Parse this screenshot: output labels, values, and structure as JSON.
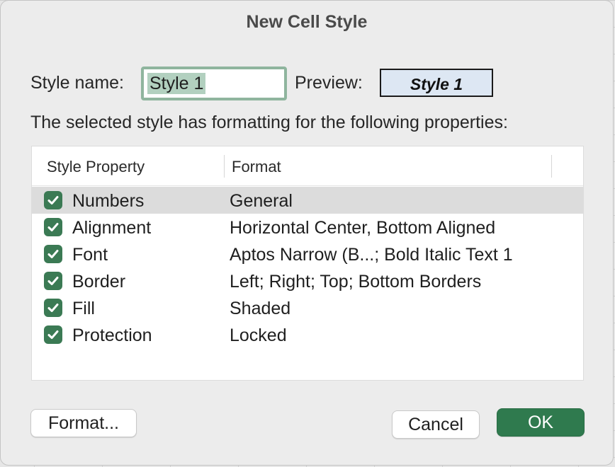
{
  "dialog": {
    "title": "New Cell Style"
  },
  "style_name": {
    "label": "Style name:",
    "value": "Style 1"
  },
  "preview": {
    "label": "Preview:",
    "text": "Style 1"
  },
  "subtitle": "The selected style has formatting for the following properties:",
  "table": {
    "columns": [
      "Style Property",
      "Format"
    ],
    "rows": [
      {
        "checked": true,
        "property": "Numbers",
        "format": "General"
      },
      {
        "checked": true,
        "property": "Alignment",
        "format": "Horizontal Center, Bottom Aligned"
      },
      {
        "checked": true,
        "property": "Font",
        "format": "Aptos Narrow (B...; Bold Italic Text 1"
      },
      {
        "checked": true,
        "property": "Border",
        "format": "Left; Right; Top; Bottom Borders"
      },
      {
        "checked": true,
        "property": "Fill",
        "format": "Shaded"
      },
      {
        "checked": true,
        "property": "Protection",
        "format": "Locked"
      }
    ]
  },
  "buttons": {
    "format": "Format...",
    "cancel": "Cancel",
    "ok": "OK"
  },
  "colors": {
    "accent": "#2f7a4e",
    "checkbox": "#3b7a54",
    "preview_fill": "#dde7f3",
    "selection": "#b2d0bf"
  },
  "icons": {
    "checkbox": "checkmark-icon"
  }
}
